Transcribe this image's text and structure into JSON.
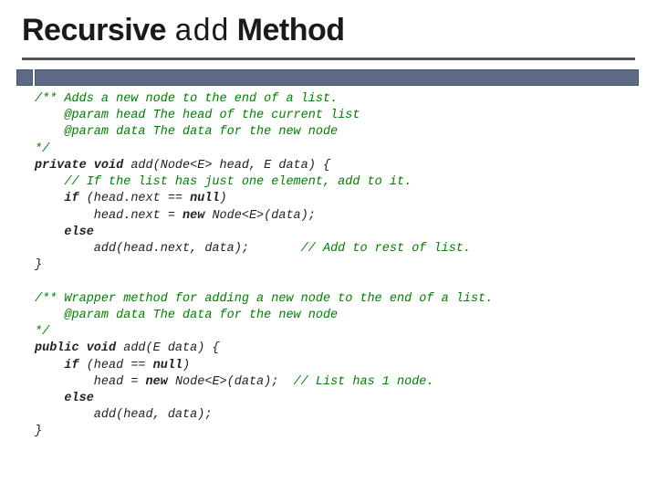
{
  "title": {
    "word1": "Recursive ",
    "mono": "add",
    "word2": " Method"
  },
  "code": {
    "c1": "/** Adds a new node to the end of a list.",
    "c2": "    @param head The head of the current list",
    "c3": "    @param data The data for the new node",
    "c4": "*/",
    "l5a": "private void",
    "l5b": " add(Node<E> head, E data) {",
    "c6": "    // If the list has just one element, add to it.",
    "l7a": "    if",
    "l7b": " (head.next == ",
    "l7c": "null",
    "l7d": ")",
    "l8": "        head.next = ",
    "l8b": "new",
    "l8c": " Node<E>(data);",
    "l9": "    else",
    "l10a": "        add(head.next, data);",
    "l10gap": "       ",
    "c10": "// Add to rest of list.",
    "l11": "}",
    "blank1": "",
    "c12": "/** Wrapper method for adding a new node to the end of a list.",
    "c13": "    @param data The data for the new node",
    "c14": "*/",
    "l15a": "public void",
    "l15b": " add(E data) {",
    "l16a": "    if",
    "l16b": " (head == ",
    "l16c": "null",
    "l16d": ")",
    "l17a": "        head = ",
    "l17b": "new",
    "l17c": " Node<E>(data);  ",
    "c17": "// List has 1 node.",
    "l18": "    else",
    "l19": "        add(head, data);",
    "l20": "}"
  }
}
